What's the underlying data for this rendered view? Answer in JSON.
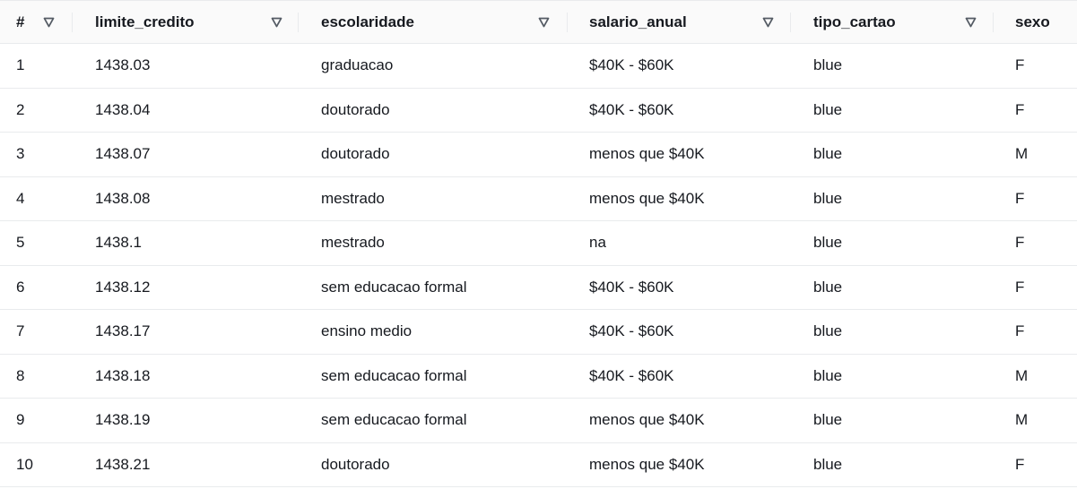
{
  "table": {
    "columns": [
      {
        "label": "#",
        "sortable": true
      },
      {
        "label": "limite_credito",
        "sortable": true
      },
      {
        "label": "escolaridade",
        "sortable": true
      },
      {
        "label": "salario_anual",
        "sortable": true
      },
      {
        "label": "tipo_cartao",
        "sortable": true
      },
      {
        "label": "sexo",
        "sortable": false
      }
    ],
    "sort_icon": "filter-triangle-down-icon",
    "rows": [
      [
        "1",
        "1438.03",
        "graduacao",
        "$40K - $60K",
        "blue",
        "F"
      ],
      [
        "2",
        "1438.04",
        "doutorado",
        "$40K - $60K",
        "blue",
        "F"
      ],
      [
        "3",
        "1438.07",
        "doutorado",
        "menos que $40K",
        "blue",
        "M"
      ],
      [
        "4",
        "1438.08",
        "mestrado",
        "menos que $40K",
        "blue",
        "F"
      ],
      [
        "5",
        "1438.1",
        "mestrado",
        "na",
        "blue",
        "F"
      ],
      [
        "6",
        "1438.12",
        "sem educacao formal",
        "$40K - $60K",
        "blue",
        "F"
      ],
      [
        "7",
        "1438.17",
        "ensino medio",
        "$40K - $60K",
        "blue",
        "F"
      ],
      [
        "8",
        "1438.18",
        "sem educacao formal",
        "$40K - $60K",
        "blue",
        "M"
      ],
      [
        "9",
        "1438.19",
        "sem educacao formal",
        "menos que $40K",
        "blue",
        "M"
      ],
      [
        "10",
        "1438.21",
        "doutorado",
        "menos que $40K",
        "blue",
        "F"
      ]
    ]
  },
  "colors": {
    "text": "#16191f",
    "header_bg": "#fafafa",
    "border": "#e9ebed",
    "icon": "#545b64"
  }
}
